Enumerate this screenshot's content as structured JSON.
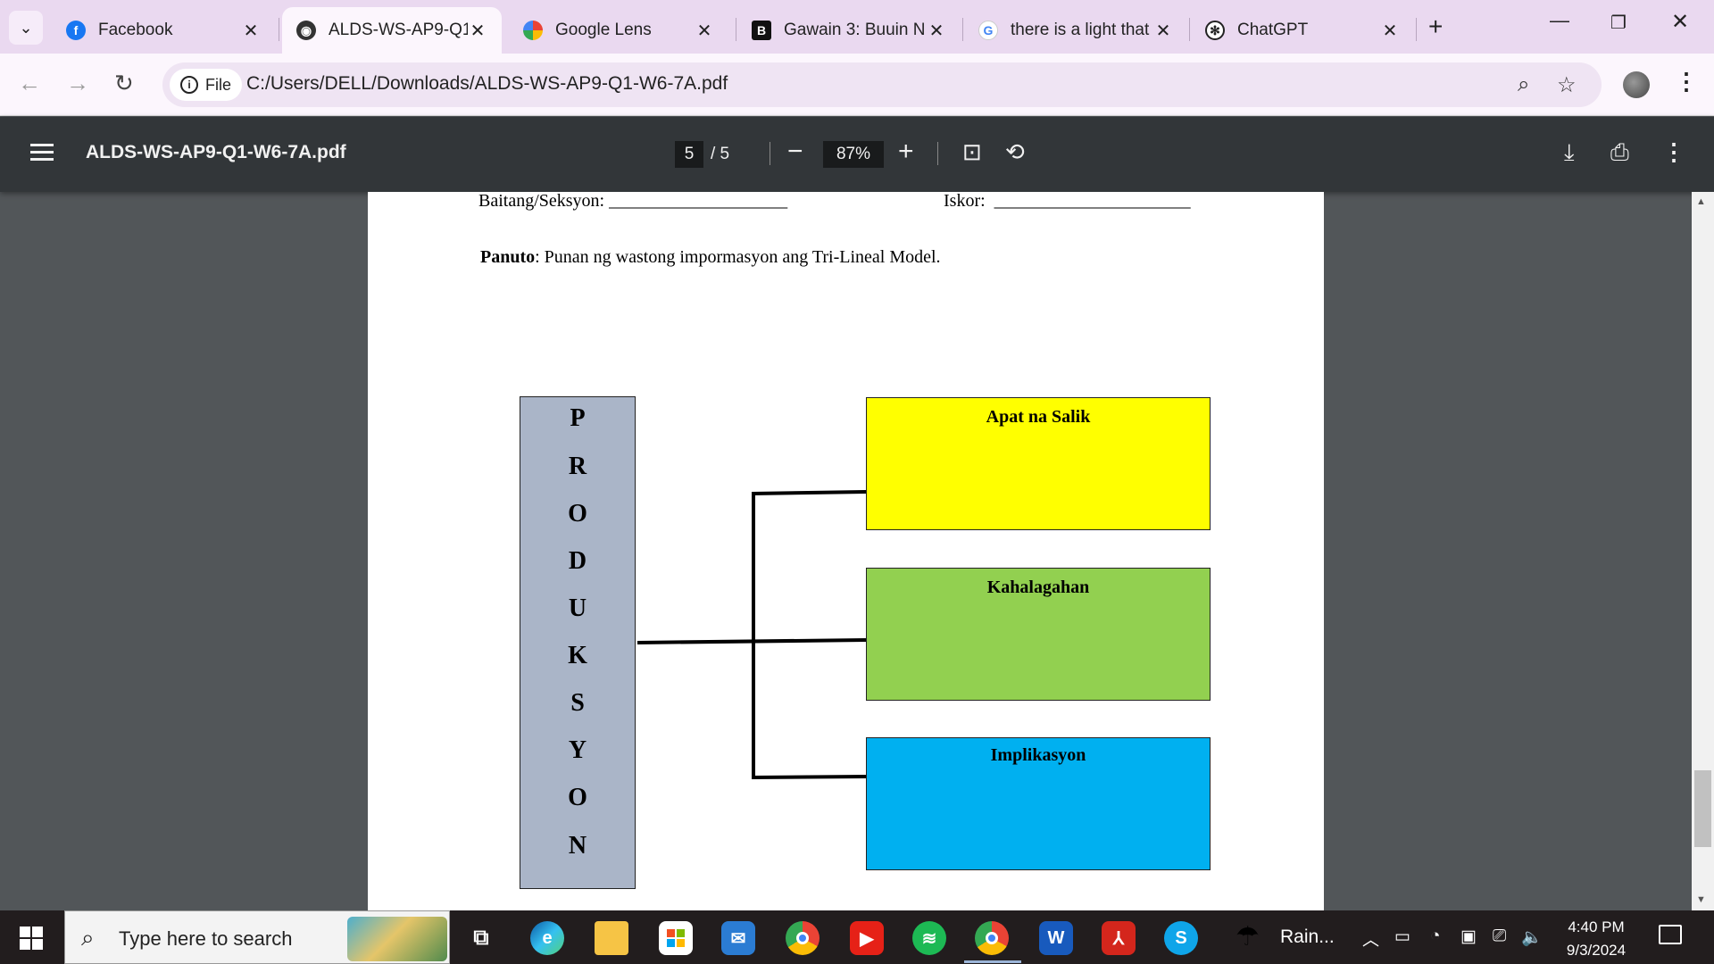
{
  "browser": {
    "tabs": [
      {
        "title": "Facebook",
        "active": false,
        "icon": "facebook-icon"
      },
      {
        "title": "ALDS-WS-AP9-Q1",
        "active": true,
        "icon": "globe-icon"
      },
      {
        "title": "Google Lens",
        "active": false,
        "icon": "google-lens-icon"
      },
      {
        "title": "Gawain 3: Buuin N",
        "active": false,
        "icon": "brainly-icon"
      },
      {
        "title": "there is a light that",
        "active": false,
        "icon": "google-icon"
      },
      {
        "title": "ChatGPT",
        "active": false,
        "icon": "chatgpt-icon"
      }
    ],
    "new_tab_label": "+",
    "address": {
      "chip_label": "File",
      "url": "C:/Users/DELL/Downloads/ALDS-WS-AP9-Q1-W6-7A.pdf"
    }
  },
  "pdf_viewer": {
    "filename": "ALDS-WS-AP9-Q1-W6-7A.pdf",
    "current_page": "5",
    "page_total": "/ 5",
    "zoom": "87%"
  },
  "document": {
    "baitang_line": "Baitang/Seksyon: ____________________",
    "iskor_line": "Iskor:  ______________________",
    "panuto_label": "Panuto",
    "panuto_text": ": Punan ng wastong impormasyon ang Tri-Lineal Model.",
    "vertical_word": [
      "P",
      "R",
      "O",
      "D",
      "U",
      "K",
      "S",
      "Y",
      "O",
      "N"
    ],
    "categories": [
      {
        "label": "Apat na Salik",
        "color": "#ffff00"
      },
      {
        "label": "Kahalagahan",
        "color": "#92d050"
      },
      {
        "label": "Implikasyon",
        "color": "#00b0f0"
      }
    ]
  },
  "taskbar": {
    "search_placeholder": "Type here to search",
    "weather_text": "Rain...",
    "time": "4:40 PM",
    "date": "9/3/2024"
  }
}
